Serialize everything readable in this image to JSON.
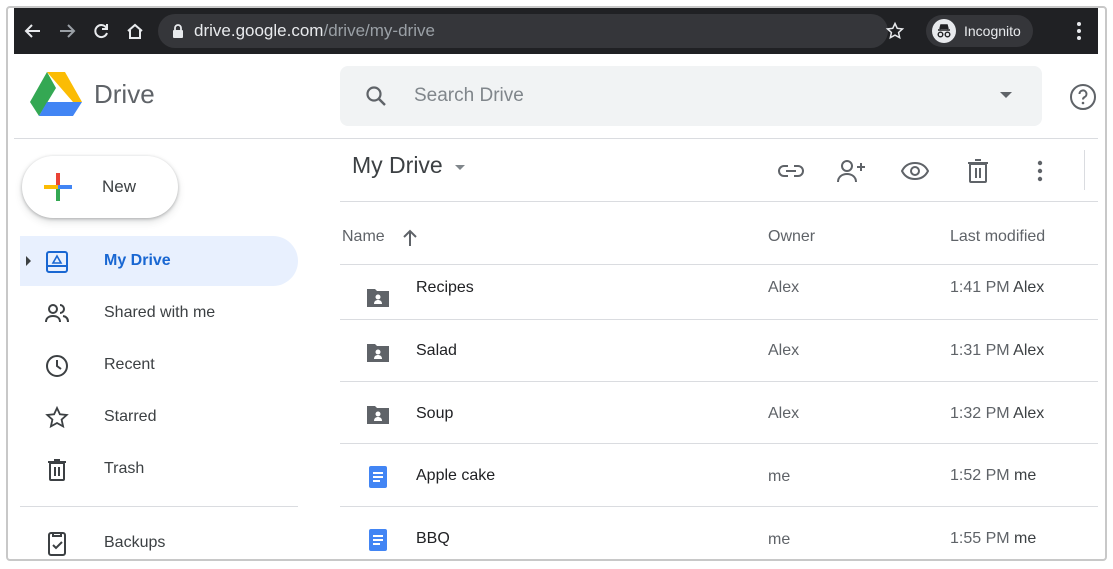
{
  "browser": {
    "url_host": "drive.google.com",
    "url_path": "/drive/my-drive",
    "incognito_label": "Incognito"
  },
  "header": {
    "app_name": "Drive",
    "search_placeholder": "Search Drive"
  },
  "sidebar": {
    "new_label": "New",
    "items": [
      {
        "label": "My Drive",
        "icon": "my-drive-icon",
        "active": true
      },
      {
        "label": "Shared with me",
        "icon": "people-icon"
      },
      {
        "label": "Recent",
        "icon": "clock-icon"
      },
      {
        "label": "Starred",
        "icon": "star-icon"
      },
      {
        "label": "Trash",
        "icon": "trash-icon"
      },
      {
        "label": "Backups",
        "icon": "backup-icon"
      }
    ]
  },
  "main": {
    "title": "My Drive",
    "toolbar": [
      "link-icon",
      "add-person-icon",
      "preview-icon",
      "trash-icon",
      "more-vert-icon"
    ],
    "columns": {
      "name": "Name",
      "owner": "Owner",
      "modified": "Last modified"
    },
    "files": [
      {
        "name": "Recipes",
        "type": "shared-folder",
        "owner": "Alex",
        "modified_time": "1:41 PM",
        "modified_by": "Alex"
      },
      {
        "name": "Salad",
        "type": "shared-folder",
        "owner": "Alex",
        "modified_time": "1:31 PM",
        "modified_by": "Alex"
      },
      {
        "name": "Soup",
        "type": "shared-folder",
        "owner": "Alex",
        "modified_time": "1:32 PM",
        "modified_by": "Alex"
      },
      {
        "name": "Apple cake",
        "type": "doc",
        "owner": "me",
        "modified_time": "1:52 PM",
        "modified_by": "me"
      },
      {
        "name": "BBQ",
        "type": "doc",
        "owner": "me",
        "modified_time": "1:55 PM",
        "modified_by": "me"
      }
    ]
  },
  "colors": {
    "accent": "#1967d2",
    "active_bg": "#e8f0fe",
    "doc_blue": "#4285f4",
    "folder_gray": "#5f6368",
    "chrome_bg": "#202124"
  }
}
